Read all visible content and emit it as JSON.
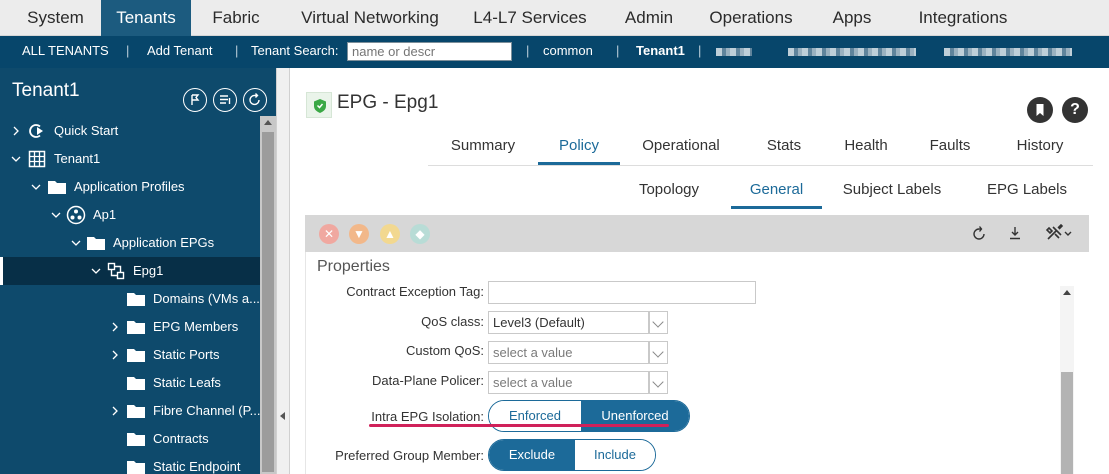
{
  "topnav": {
    "tabs": [
      "System",
      "Tenants",
      "Fabric",
      "Virtual Networking",
      "L4-L7 Services",
      "Admin",
      "Operations",
      "Apps",
      "Integrations"
    ],
    "active": "Tenants"
  },
  "subnav": {
    "all_tenants": "ALL TENANTS",
    "add_tenant": "Add Tenant",
    "search_label": "Tenant Search:",
    "search_placeholder": "name or descr",
    "common": "common",
    "current": "Tenant1"
  },
  "sidebar": {
    "title": "Tenant1",
    "tree": [
      "Quick Start",
      "Tenant1",
      "Application Profiles",
      "Ap1",
      "Application EPGs",
      "Epg1",
      "Domains (VMs a...",
      "EPG Members",
      "Static Ports",
      "Static Leafs",
      "Fibre Channel (P...",
      "Contracts",
      "Static Endpoint"
    ]
  },
  "main": {
    "title": "EPG - Epg1",
    "tabs": [
      "Summary",
      "Policy",
      "Operational",
      "Stats",
      "Health",
      "Faults",
      "History"
    ],
    "active_tab": "Policy",
    "subtabs": [
      "Topology",
      "General",
      "Subject Labels",
      "EPG Labels"
    ],
    "active_subtab": "General",
    "props_title": "Properties",
    "fields": {
      "contract_exception_tag": {
        "label": "Contract Exception Tag:",
        "value": ""
      },
      "qos_class": {
        "label": "QoS class:",
        "value": "Level3 (Default)"
      },
      "custom_qos": {
        "label": "Custom QoS:",
        "placeholder": "select a value"
      },
      "data_plane_policer": {
        "label": "Data-Plane Policer:",
        "placeholder": "select a value"
      },
      "intra_epg_isolation": {
        "label": "Intra EPG Isolation:",
        "options": [
          "Enforced",
          "Unenforced"
        ],
        "selected": "Unenforced"
      },
      "preferred_group_member": {
        "label": "Preferred Group Member:",
        "options": [
          "Exclude",
          "Include"
        ],
        "selected": "Exclude"
      }
    }
  },
  "colors": {
    "nav_active": "#1c5b7f",
    "subnav_bg": "#07466b",
    "sidebar_bg": "#0e4a6c",
    "accent": "#1c6a99",
    "annotation": "#d0215a"
  }
}
